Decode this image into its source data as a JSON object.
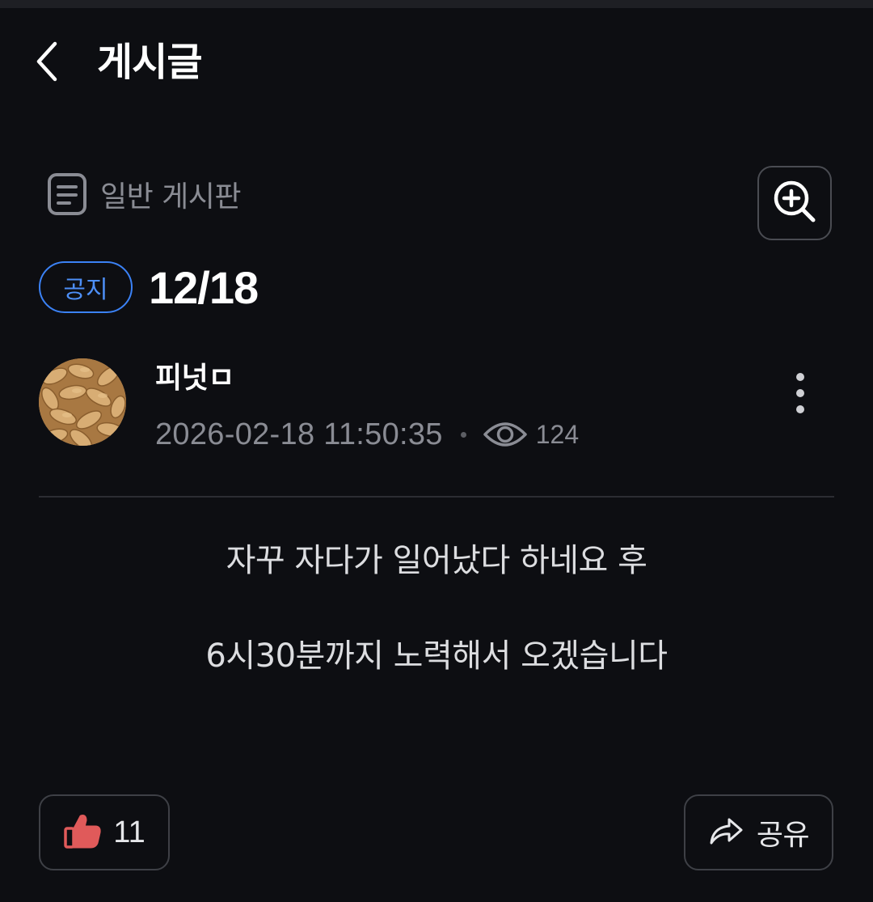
{
  "header": {
    "title": "게시글",
    "back_icon": "chevron-left-icon"
  },
  "board": {
    "icon": "document-icon",
    "label": "일반 게시판",
    "zoom_icon": "zoom-in-icon"
  },
  "post": {
    "badge": "공지",
    "title": "12/18",
    "author": {
      "name": "피넛ㅁ",
      "avatar": "peanut-avatar"
    },
    "date": "2026-02-18 11:50:35",
    "views": "124",
    "more_icon": "more-vertical-icon",
    "body": [
      "자꾸 자다가 일어났다 하네요 후",
      "6시30분까지 노력해서 오겠습니다"
    ]
  },
  "actions": {
    "like_icon": "thumbs-up-icon",
    "like_count": "11",
    "share_icon": "share-icon",
    "share_label": "공유"
  },
  "colors": {
    "background": "#0d0e12",
    "accent_blue": "#3b82f6",
    "like_red": "#e05a5a",
    "muted_text": "#8a8c94"
  }
}
